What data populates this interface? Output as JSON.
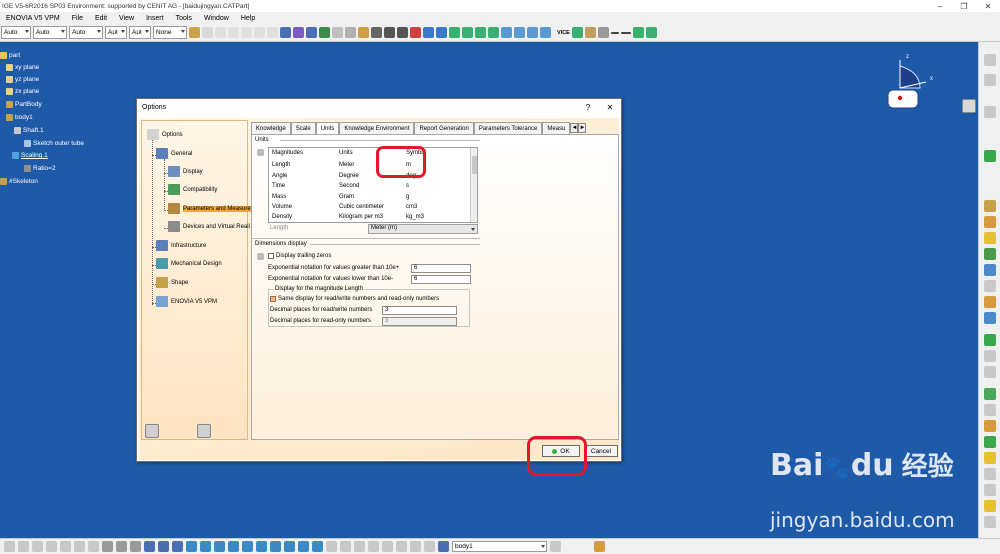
{
  "window": {
    "title": "IGE V5-6R2016 SP03 Environment: supported by CENIT AG - [baidujingyan.CATPart]",
    "buttons": [
      "–",
      "❐",
      "✕"
    ]
  },
  "menu": [
    "ENOVIA V5 VPM",
    "File",
    "Edit",
    "View",
    "Insert",
    "Tools",
    "Window",
    "Help"
  ],
  "toolbar": {
    "combos": [
      "Auto",
      "Auto",
      "Auto",
      "Aut",
      "Aut",
      "None"
    ],
    "view_label": "VICE"
  },
  "tree": {
    "nodes": [
      "part",
      "xy plane",
      "yz plane",
      "zx plane",
      "PartBody",
      "body1",
      "Shaft.1",
      "Sketch outer tube",
      "Scaling.1",
      "Ratio=2",
      "#Skeleton"
    ]
  },
  "compass": {
    "axis_z": "z",
    "axis_x": "x"
  },
  "dialog": {
    "title": "Options",
    "help": "?",
    "close": "✕",
    "left_tree": [
      "Options",
      "General",
      "Display",
      "Compatibility",
      "Parameters and Measure",
      "Devices and Virtual Reali",
      "Infrastructure",
      "Mechanical Design",
      "Shape",
      "ENOVIA V5 VPM"
    ],
    "tabs": [
      "Knowledge",
      "Scale",
      "Units",
      "Knowledge Environment",
      "Report Generation",
      "Parameters Tolerance",
      "Measu"
    ],
    "tab_nav": [
      "◄",
      "►"
    ],
    "units": {
      "section": "Units",
      "headers": [
        "Magnitudes",
        "Units",
        "Symbol"
      ],
      "rows": [
        [
          "Length",
          "Meter",
          "m"
        ],
        [
          "Angle",
          "Degree",
          "deg"
        ],
        [
          "Time",
          "Second",
          "s"
        ],
        [
          "Mass",
          "Gram",
          "g"
        ],
        [
          "Volume",
          "Cubic centimeter",
          "cm3"
        ],
        [
          "Density",
          "Kilogram per m3",
          "kg_m3"
        ]
      ],
      "length_label": "Length",
      "length_value": "Meter (m)"
    },
    "dimensions": {
      "section": "Dimensions display",
      "trailing_zeros": "Display trailing zeros",
      "exp_greater_label": "Exponential notation for values greater than 10e+",
      "exp_greater_value": "6",
      "exp_lower_label": "Exponential notation for values lower than 10e-",
      "exp_lower_value": "6",
      "magnitude_group": "Display for the magnitude Length",
      "same_display": "Same display for read/write numbers and read-only numbers",
      "rw_label": "Decimal places for read/write numbers",
      "rw_value": "3",
      "ro_label": "Decimal places for read-only numbers",
      "ro_value": "3"
    },
    "ok": "OK",
    "cancel": "Cancel"
  },
  "bottom": {
    "combo": "body1"
  },
  "watermark": {
    "logo": "Bai",
    "logo2": "du",
    "cn": "经验",
    "url": "jingyan.baidu.com"
  },
  "colors": {
    "workspace": "#1f5aa8",
    "highlight": "#f7a33c",
    "annotation": "#e2182c"
  }
}
